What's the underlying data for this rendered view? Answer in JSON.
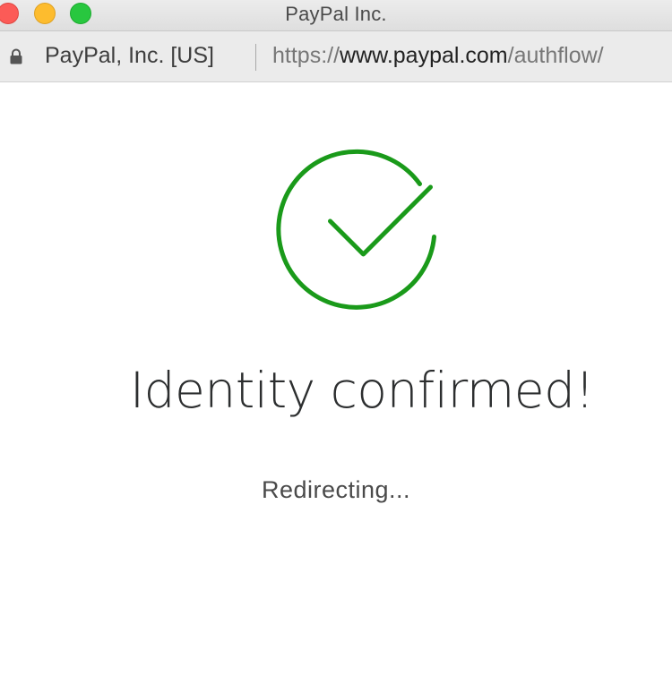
{
  "window": {
    "title": "PayPal Inc."
  },
  "addressbar": {
    "cert_label": "PayPal, Inc. [US]",
    "url_scheme": "https://",
    "url_domain": "www.paypal.com",
    "url_path": "/authflow/"
  },
  "content": {
    "heading": "Identity confirmed!",
    "status": "Redirecting..."
  },
  "colors": {
    "success_green": "#1a9a1a",
    "text_dark": "#2c2e2f"
  },
  "icons": {
    "lock": "lock-icon",
    "check": "check-circle-icon"
  }
}
